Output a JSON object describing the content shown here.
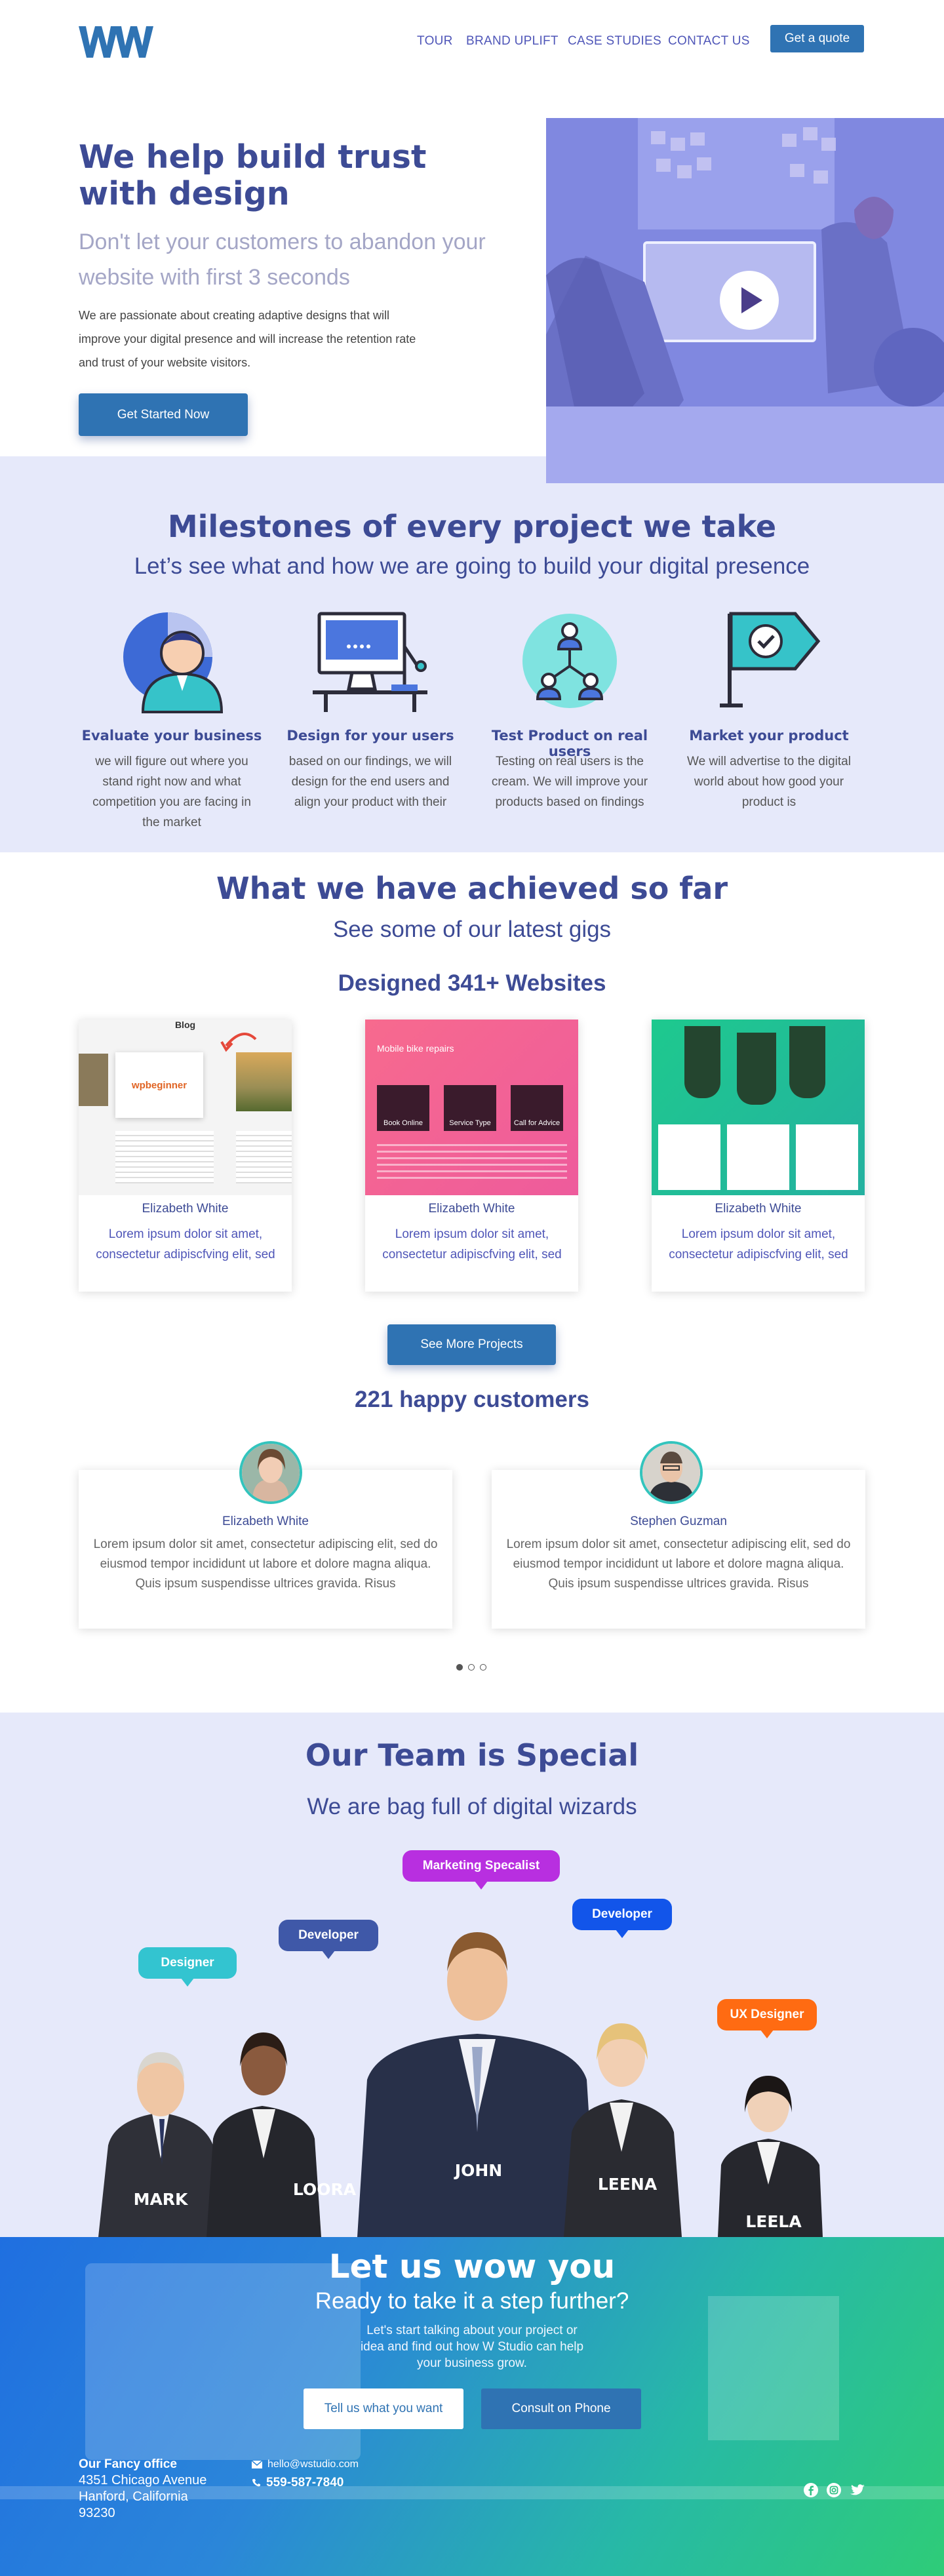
{
  "nav": {
    "logo_text": "W W",
    "items": [
      "TOUR",
      "BRAND UPLIFT",
      "CASE STUDIES",
      "CONTACT US"
    ],
    "cta": "Get a quote"
  },
  "hero": {
    "title": "We help build trust with design",
    "subtitle": "Don't let your customers to abandon your website with first 3 seconds",
    "body": "We are passionate about creating adaptive designs that will improve your digital presence and will increase the retention rate and trust of your website visitors.",
    "button": "Get Started Now"
  },
  "milestones": {
    "title": "Milestones of every project we take",
    "subtitle": "Let’s see what and how we are going to build your digital presence",
    "items": [
      {
        "title": "Evaluate your business",
        "text": "we will figure out where you stand right now and what competition you are facing in the market",
        "icon": "business-analysis-icon"
      },
      {
        "title": "Design for your users",
        "text": "based on our findings, we will design for the end users and align your product with their",
        "icon": "design-desk-icon"
      },
      {
        "title": "Test Product on real users",
        "text": "Testing on real users is the cream. We will improve your products based on findings",
        "icon": "user-network-icon"
      },
      {
        "title": "Market your product",
        "text": "We will advertise to the digital world about how good your product is",
        "icon": "flag-check-icon"
      }
    ]
  },
  "achieved": {
    "title": "What we have achieved so far",
    "subtitle": "See some of our latest gigs",
    "designed": "Designed 341+ Websites",
    "cards": [
      {
        "name": "Elizabeth White",
        "text": "Lorem ipsum dolor sit amet, consectetur adipiscfving elit, sed",
        "img_title": "Blog",
        "img_brand": "wpbeginner"
      },
      {
        "name": "Elizabeth White",
        "text": "Lorem ipsum dolor sit amet, consectetur adipiscfving elit, sed",
        "img_title": "Mobile bike repairs",
        "img_tiles": [
          "Book Online",
          "Service Type",
          "Call for Advice"
        ]
      },
      {
        "name": "Elizabeth White",
        "text": "Lorem ipsum dolor sit amet, consectetur adipiscfving elit, sed"
      }
    ],
    "more_button": "See More Projects",
    "happy": "221 happy customers",
    "testimonials": [
      {
        "name": "Elizabeth White",
        "text": "Lorem ipsum dolor sit amet, consectetur adipiscing elit, sed do eiusmod tempor incididunt ut labore et dolore magna aliqua. Quis ipsum suspendisse ultrices gravida. Risus"
      },
      {
        "name": "Stephen Guzman",
        "text": "Lorem ipsum dolor sit amet, consectetur adipiscing elit, sed do eiusmod tempor incididunt ut labore et dolore magna aliqua. Quis ipsum suspendisse ultrices gravida. Risus"
      }
    ]
  },
  "team": {
    "title": "Our Team is Special",
    "subtitle": "We are bag full of digital wizards",
    "members": [
      {
        "name": "MARK",
        "role": "Designer",
        "color": "#33c4d0"
      },
      {
        "name": "LOORA",
        "role": "Developer",
        "color": "#3f58a8"
      },
      {
        "name": "JOHN",
        "role": "Marketing Specalist",
        "color": "#b82fe0"
      },
      {
        "name": "LEENA",
        "role": "Developer",
        "color": "#1255ea"
      },
      {
        "name": "LEELA",
        "role": "UX Designer",
        "color": "#ff6b12"
      }
    ]
  },
  "cta": {
    "title": "Let us wow you",
    "subtitle": "Ready to take it a step further?",
    "body": "Let's start talking about your project or idea and find out how W Studio can help your business grow.",
    "button_primary": "Tell us what you want",
    "button_secondary": "Consult on Phone"
  },
  "footer": {
    "office_title": "Our Fancy office",
    "address_line1": "4351 Chicago Avenue",
    "address_line2": "Hanford, California",
    "address_line3": "93230",
    "email": "hello@wstudio.com",
    "phone": "559-587-7840",
    "social_icons": [
      "facebook-icon",
      "instagram-icon",
      "twitter-icon"
    ]
  }
}
